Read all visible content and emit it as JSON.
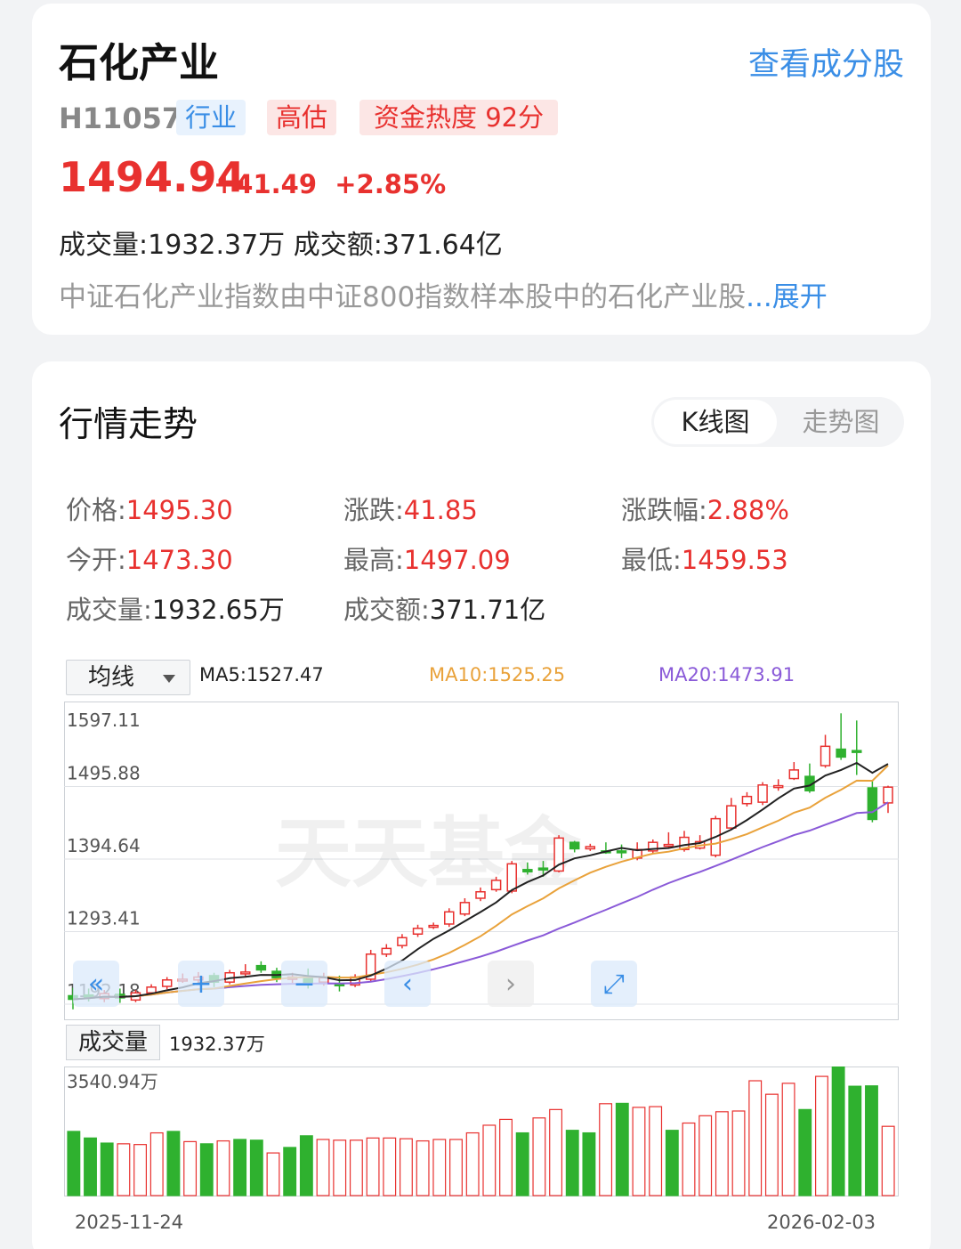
{
  "header": {
    "title": "石化产业",
    "view_components": "查看成分股",
    "code": "H11057",
    "tags": [
      "行业",
      "高估",
      "资金热度 92分"
    ],
    "price": "1494.94",
    "change": "+41.49",
    "change_pct": "+2.85%",
    "volume_line": "成交量:1932.37万   成交额:371.64亿",
    "description": "中证石化产业指数由中证800指数样本股中的石化产业股",
    "expand": "...展开"
  },
  "market": {
    "section_title": "行情走势",
    "tabs": [
      "K线图",
      "走势图"
    ],
    "active_tab": "K线图",
    "stats": [
      {
        "label": "价格:",
        "value": "1495.30",
        "color": "red"
      },
      {
        "label": "涨跌:",
        "value": "41.85",
        "color": "red"
      },
      {
        "label": "涨跌幅:",
        "value": "2.88%",
        "color": "red"
      },
      {
        "label": "今开:",
        "value": "1473.30",
        "color": "red"
      },
      {
        "label": "最高:",
        "value": "1497.09",
        "color": "red"
      },
      {
        "label": "最低:",
        "value": "1459.53",
        "color": "red"
      },
      {
        "label": "成交量:",
        "value": "1932.65万",
        "color": "dark"
      },
      {
        "label": "成交额:",
        "value": "371.71亿",
        "color": "dark"
      }
    ],
    "ma_select": "均线",
    "ma5": "MA5:1527.47",
    "ma10": "MA10:1525.25",
    "ma20": "MA20:1473.91",
    "volume_label": "成交量",
    "volume_value": "1932.37万",
    "start_date": "2025-11-24",
    "end_date": "2026-02-03",
    "watermark": "天天基金"
  },
  "colors": {
    "up": "#e8312f",
    "down": "#2fb12f",
    "ma5": "#222222",
    "ma10": "#e9a23b",
    "ma20": "#8a5ad8",
    "link": "#3a8ee6"
  },
  "chart_data": {
    "type": "candlestick",
    "y_ticks": [
      "1597.11",
      "1495.88",
      "1394.64",
      "1293.41",
      "1192.18"
    ],
    "ylim": [
      1192.18,
      1597.11
    ],
    "candles": [
      [
        1204,
        1199,
        1215,
        1185,
        0
      ],
      [
        1205,
        1202,
        1214,
        1196,
        0
      ],
      [
        1200,
        1207,
        1212,
        1195,
        1
      ],
      [
        1206,
        1201,
        1214,
        1194,
        0
      ],
      [
        1198,
        1208,
        1212,
        1195,
        1
      ],
      [
        1208,
        1216,
        1220,
        1205,
        1
      ],
      [
        1217,
        1226,
        1230,
        1213,
        1
      ],
      [
        1226,
        1227,
        1235,
        1222,
        1
      ],
      [
        1226,
        1230,
        1237,
        1222,
        1
      ],
      [
        1232,
        1223,
        1236,
        1216,
        0
      ],
      [
        1223,
        1236,
        1240,
        1220,
        1
      ],
      [
        1237,
        1236,
        1248,
        1230,
        1
      ],
      [
        1246,
        1240,
        1252,
        1236,
        0
      ],
      [
        1238,
        1229,
        1243,
        1223,
        0
      ],
      [
        1227,
        1230,
        1236,
        1222,
        1
      ],
      [
        1231,
        1222,
        1242,
        1214,
        0
      ],
      [
        1223,
        1229,
        1236,
        1218,
        1
      ],
      [
        1221,
        1218,
        1232,
        1210,
        0
      ],
      [
        1219,
        1230,
        1234,
        1216,
        1
      ],
      [
        1227,
        1262,
        1268,
        1224,
        1
      ],
      [
        1262,
        1270,
        1276,
        1258,
        1
      ],
      [
        1274,
        1285,
        1290,
        1270,
        1
      ],
      [
        1290,
        1298,
        1303,
        1286,
        1
      ],
      [
        1300,
        1302,
        1306,
        1297,
        1
      ],
      [
        1304,
        1321,
        1326,
        1300,
        1
      ],
      [
        1318,
        1334,
        1340,
        1315,
        1
      ],
      [
        1340,
        1349,
        1355,
        1336,
        1
      ],
      [
        1352,
        1365,
        1370,
        1349,
        1
      ],
      [
        1350,
        1388,
        1392,
        1347,
        1
      ],
      [
        1380,
        1377,
        1390,
        1373,
        0
      ],
      [
        1382,
        1380,
        1392,
        1370,
        0
      ],
      [
        1378,
        1424,
        1428,
        1376,
        1
      ],
      [
        1418,
        1409,
        1420,
        1404,
        0
      ],
      [
        1412,
        1409,
        1416,
        1406,
        1
      ],
      [
        1406,
        1404,
        1418,
        1402,
        0
      ],
      [
        1406,
        1405,
        1415,
        1396,
        0
      ],
      [
        1396,
        1408,
        1418,
        1393,
        1
      ],
      [
        1406,
        1418,
        1422,
        1402,
        1
      ],
      [
        1415,
        1415,
        1432,
        1410,
        1
      ],
      [
        1408,
        1425,
        1434,
        1405,
        1
      ],
      [
        1410,
        1419,
        1428,
        1408,
        1
      ],
      [
        1400,
        1451,
        1455,
        1397,
        1
      ],
      [
        1438,
        1469,
        1480,
        1435,
        1
      ],
      [
        1472,
        1482,
        1488,
        1468,
        1
      ],
      [
        1474,
        1498,
        1502,
        1470,
        1
      ],
      [
        1496,
        1497,
        1506,
        1490,
        1
      ],
      [
        1507,
        1519,
        1530,
        1505,
        1
      ],
      [
        1510,
        1490,
        1528,
        1487,
        0
      ],
      [
        1525,
        1552,
        1568,
        1522,
        1
      ],
      [
        1548,
        1537,
        1598,
        1533,
        0
      ],
      [
        1544,
        1546,
        1588,
        1512,
        0
      ],
      [
        1494,
        1450,
        1504,
        1446,
        0
      ],
      [
        1473,
        1495,
        1497,
        1459,
        1
      ]
    ],
    "ma5_last": 1527.47,
    "ma10_last": 1525.25,
    "ma20_last": 1473.91,
    "volume": [
      [
        1760,
        0
      ],
      [
        1580,
        0
      ],
      [
        1440,
        0
      ],
      [
        1420,
        1
      ],
      [
        1400,
        1
      ],
      [
        1720,
        1
      ],
      [
        1760,
        0
      ],
      [
        1480,
        1
      ],
      [
        1420,
        0
      ],
      [
        1500,
        1
      ],
      [
        1540,
        0
      ],
      [
        1520,
        0
      ],
      [
        1170,
        1
      ],
      [
        1320,
        0
      ],
      [
        1640,
        0
      ],
      [
        1540,
        1
      ],
      [
        1520,
        1
      ],
      [
        1520,
        1
      ],
      [
        1580,
        1
      ],
      [
        1580,
        1
      ],
      [
        1560,
        1
      ],
      [
        1500,
        1
      ],
      [
        1540,
        1
      ],
      [
        1540,
        1
      ],
      [
        1720,
        1
      ],
      [
        1930,
        1
      ],
      [
        2090,
        1
      ],
      [
        1720,
        0
      ],
      [
        2130,
        1
      ],
      [
        2360,
        1
      ],
      [
        1790,
        0
      ],
      [
        1720,
        0
      ],
      [
        2520,
        1
      ],
      [
        2530,
        0
      ],
      [
        2420,
        1
      ],
      [
        2440,
        1
      ],
      [
        1790,
        0
      ],
      [
        1990,
        1
      ],
      [
        2190,
        1
      ],
      [
        2300,
        1
      ],
      [
        2320,
        1
      ],
      [
        3150,
        1
      ],
      [
        2780,
        1
      ],
      [
        3080,
        1
      ],
      [
        2360,
        0
      ],
      [
        3270,
        1
      ],
      [
        3540,
        0
      ],
      [
        3000,
        0
      ],
      [
        3010,
        0
      ],
      [
        1900,
        1
      ]
    ],
    "volume_max": 3540.94
  }
}
